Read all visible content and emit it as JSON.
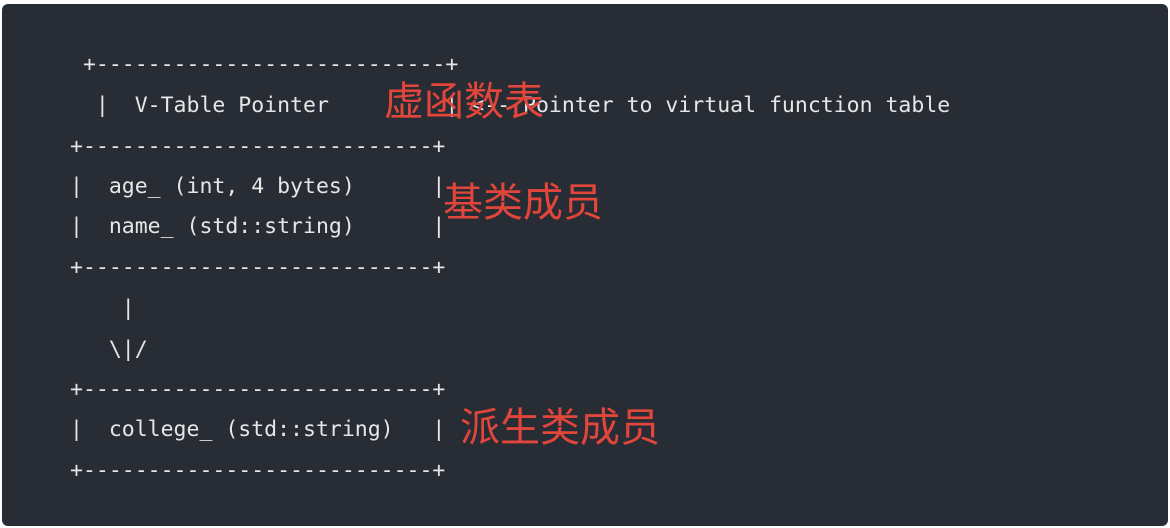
{
  "diagram": {
    "lines": [
      " +---------------------------+",
      "  |  V-Table Pointer         | <-- Pointer to virtual function table",
      "+---------------------------+",
      "|  age_ (int, 4 bytes)      |",
      "|  name_ (std::string)      |",
      "+---------------------------+",
      "    |",
      "   \\|/",
      "+---------------------------+",
      "|  college_ (std::string)   |",
      "+---------------------------+"
    ],
    "annotations": {
      "vtable": "虚函数表",
      "base_members": "基类成员",
      "derived_members": "派生类成员"
    },
    "colors": {
      "background": "#282c34",
      "text": "#e6e6e6",
      "annotation": "#e2463b"
    }
  }
}
